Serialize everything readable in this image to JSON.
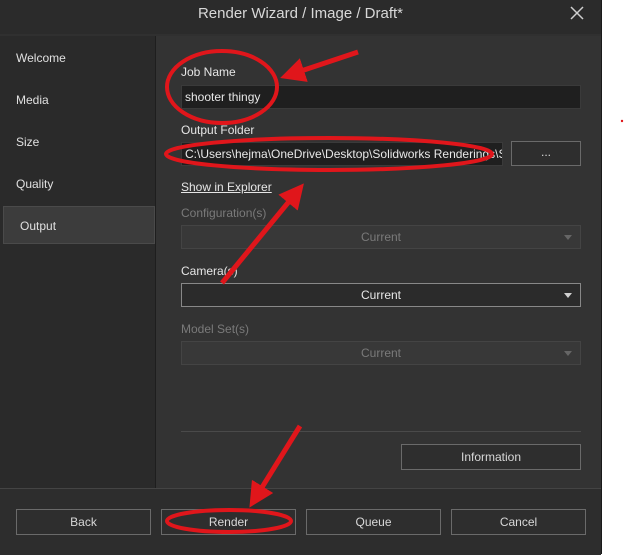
{
  "window": {
    "title": "Render Wizard / Image / Draft*"
  },
  "sidebar": {
    "items": [
      {
        "label": "Welcome"
      },
      {
        "label": "Media"
      },
      {
        "label": "Size"
      },
      {
        "label": "Quality"
      },
      {
        "label": "Output",
        "active": true
      }
    ]
  },
  "output": {
    "job_name_label": "Job Name",
    "job_name_value": "shooter thingy",
    "output_folder_label": "Output Folder",
    "output_folder_value": "C:\\Users\\hejma\\OneDrive\\Desktop\\Solidworks Renderings\\S",
    "browse_label": "...",
    "show_in_explorer": "Show in Explorer",
    "configurations_label": "Configuration(s)",
    "configurations_value": "Current",
    "cameras_label": "Camera(s)",
    "cameras_value": "Current",
    "model_sets_label": "Model Set(s)",
    "model_sets_value": "Current",
    "information_label": "Information"
  },
  "footer": {
    "back": "Back",
    "render": "Render",
    "queue": "Queue",
    "cancel": "Cancel"
  },
  "colors": {
    "annotation": "#e0161b",
    "background": "#303030"
  }
}
